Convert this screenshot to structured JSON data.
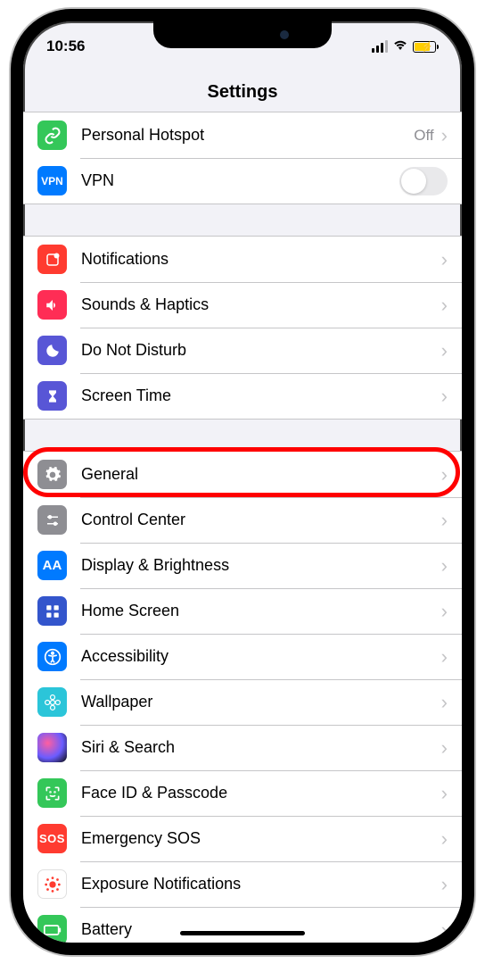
{
  "status": {
    "time": "10:56"
  },
  "header": {
    "title": "Settings"
  },
  "group1": {
    "personal_hotspot": {
      "label": "Personal Hotspot",
      "value": "Off",
      "icon_bg": "#34c759"
    },
    "vpn": {
      "label": "VPN",
      "icon_bg": "#007aff",
      "icon_text": "VPN"
    }
  },
  "group2": {
    "notifications": {
      "label": "Notifications",
      "icon_bg": "#ff3b30"
    },
    "sounds": {
      "label": "Sounds & Haptics",
      "icon_bg": "#ff2d55"
    },
    "dnd": {
      "label": "Do Not Disturb",
      "icon_bg": "#5856d6"
    },
    "screen_time": {
      "label": "Screen Time",
      "icon_bg": "#5856d6"
    }
  },
  "group3": {
    "general": {
      "label": "General",
      "icon_bg": "#8e8e93"
    },
    "control_center": {
      "label": "Control Center",
      "icon_bg": "#8e8e93"
    },
    "display": {
      "label": "Display & Brightness",
      "icon_bg": "#007aff",
      "icon_text": "AA"
    },
    "home_screen": {
      "label": "Home Screen",
      "icon_bg": "#3355cc"
    },
    "accessibility": {
      "label": "Accessibility",
      "icon_bg": "#007aff"
    },
    "wallpaper": {
      "label": "Wallpaper",
      "icon_bg": "#2bc5d9"
    },
    "siri": {
      "label": "Siri & Search",
      "icon_bg": "#1a1a1a"
    },
    "face_id": {
      "label": "Face ID & Passcode",
      "icon_bg": "#34c759"
    },
    "emergency": {
      "label": "Emergency SOS",
      "icon_bg": "#ff3b30",
      "icon_text": "SOS"
    },
    "exposure": {
      "label": "Exposure Notifications",
      "icon_bg": "#ffffff"
    },
    "battery": {
      "label": "Battery",
      "icon_bg": "#34c759"
    }
  },
  "highlight": {
    "target": "general"
  }
}
